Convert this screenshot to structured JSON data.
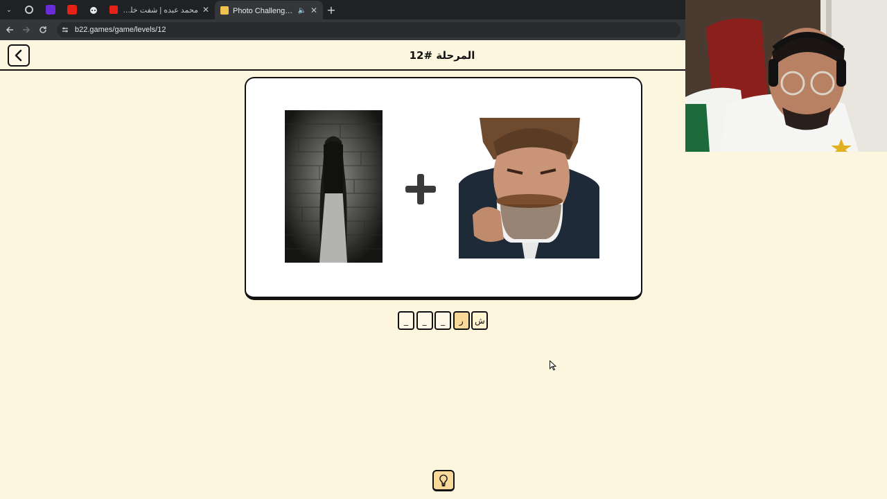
{
  "browser": {
    "tabs": [
      {
        "title": "محمد عبده | شفت خلي - يعد غيا",
        "favicon_color": "#e62117",
        "active": false
      },
      {
        "title": "Photo Challenge - تحدي الصور",
        "favicon_color": "#f2c14e",
        "active": true
      }
    ],
    "pinned_tabs": [
      {
        "icon": "pinned-app-icon",
        "color": "#9aa0a6"
      },
      {
        "icon": "pinned-twitch-icon",
        "color": "#6a2bd8"
      },
      {
        "icon": "pinned-youtube-icon",
        "color": "#e62117"
      },
      {
        "icon": "pinned-reddit-icon",
        "color": "#9aa0a6"
      }
    ],
    "new_tab_label": "+",
    "url": "b22.games/game/levels/12"
  },
  "page": {
    "level_title": "المرحلة #12",
    "answer_slots": [
      "ش",
      "ر",
      "_",
      "_",
      "_"
    ],
    "images": [
      {
        "name": "ghost-girl-image",
        "subject": "ghost girl by brick wall"
      },
      {
        "name": "man-drinking-coffee-image",
        "subject": "man smelling coffee cup"
      }
    ],
    "plus_symbol": "plus",
    "hint_icon": "lightbulb-icon"
  },
  "colors": {
    "page_bg": "#fdf6df",
    "slot_filled": "#f9d99a",
    "border": "#111111"
  }
}
